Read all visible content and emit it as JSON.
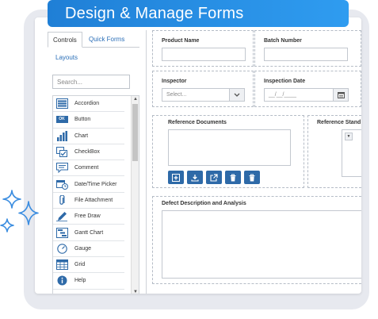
{
  "banner": {
    "title": "Design & Manage Forms"
  },
  "tabs": {
    "controls": "Controls",
    "quick_forms": "Quick Forms",
    "layouts": "Layouts"
  },
  "search": {
    "placeholder": "Search..."
  },
  "controls": [
    {
      "label": "Accordion",
      "icon": "accordion-icon"
    },
    {
      "label": "Button",
      "icon": "button-icon",
      "icon_text": "OK"
    },
    {
      "label": "Chart",
      "icon": "chart-icon"
    },
    {
      "label": "CheckBox",
      "icon": "checkbox-icon"
    },
    {
      "label": "Comment",
      "icon": "comment-icon"
    },
    {
      "label": "Date/Time Picker",
      "icon": "datetime-icon"
    },
    {
      "label": "File Attachment",
      "icon": "attachment-icon"
    },
    {
      "label": "Free Draw",
      "icon": "pencil-icon"
    },
    {
      "label": "Gantt Chart",
      "icon": "gantt-icon"
    },
    {
      "label": "Gauge",
      "icon": "gauge-icon"
    },
    {
      "label": "Grid",
      "icon": "grid-icon"
    },
    {
      "label": "Help",
      "icon": "info-icon"
    }
  ],
  "form": {
    "product_name": {
      "label": "Product Name",
      "value": ""
    },
    "batch_number": {
      "label": "Batch Number",
      "value": ""
    },
    "inspector": {
      "label": "Inspector",
      "placeholder": "Select..."
    },
    "inspection_date": {
      "label": "Inspection Date",
      "placeholder": "__/__/____"
    },
    "reference_documents": {
      "label": "Reference Documents"
    },
    "reference_standards": {
      "label": "Reference Stand"
    },
    "defect_description": {
      "label": "Defect Description and Analysis"
    }
  },
  "colors": {
    "accent": "#1f7fd6",
    "button": "#2e6aa8",
    "card": "#e7e9ef",
    "sparkle": "#3b8de0"
  }
}
